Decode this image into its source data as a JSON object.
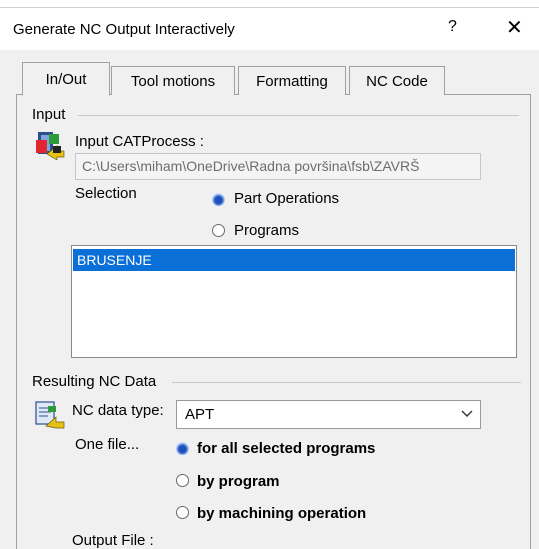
{
  "window": {
    "title": "Generate NC Output Interactively",
    "help_label": "?",
    "close_label": "✕"
  },
  "tabs": [
    {
      "label": "In/Out"
    },
    {
      "label": "Tool motions"
    },
    {
      "label": "Formatting"
    },
    {
      "label": "NC Code"
    }
  ],
  "input": {
    "section_label": "Input",
    "catprocess_label": "Input CATProcess :",
    "catprocess_path": "C:\\Users\\miham\\OneDrive\\Radna površina\\fsb\\ZAVRŠ",
    "selection_label": "Selection",
    "options": [
      {
        "label": "Part Operations",
        "selected": true
      },
      {
        "label": "Programs",
        "selected": false
      }
    ],
    "list_items": [
      "BRUSENJE"
    ]
  },
  "result": {
    "section_label": "Resulting NC Data",
    "nc_type_label": "NC data type:",
    "nc_type_value": "APT",
    "one_file_label": "One file...",
    "options": [
      {
        "label": "for all selected programs",
        "selected": true
      },
      {
        "label": "by program",
        "selected": false
      },
      {
        "label": "by machining operation",
        "selected": false
      }
    ],
    "output_file_label": "Output File :"
  },
  "colors": {
    "selection": "#0a6fd6",
    "dialog_bg": "#f0f0f0"
  }
}
